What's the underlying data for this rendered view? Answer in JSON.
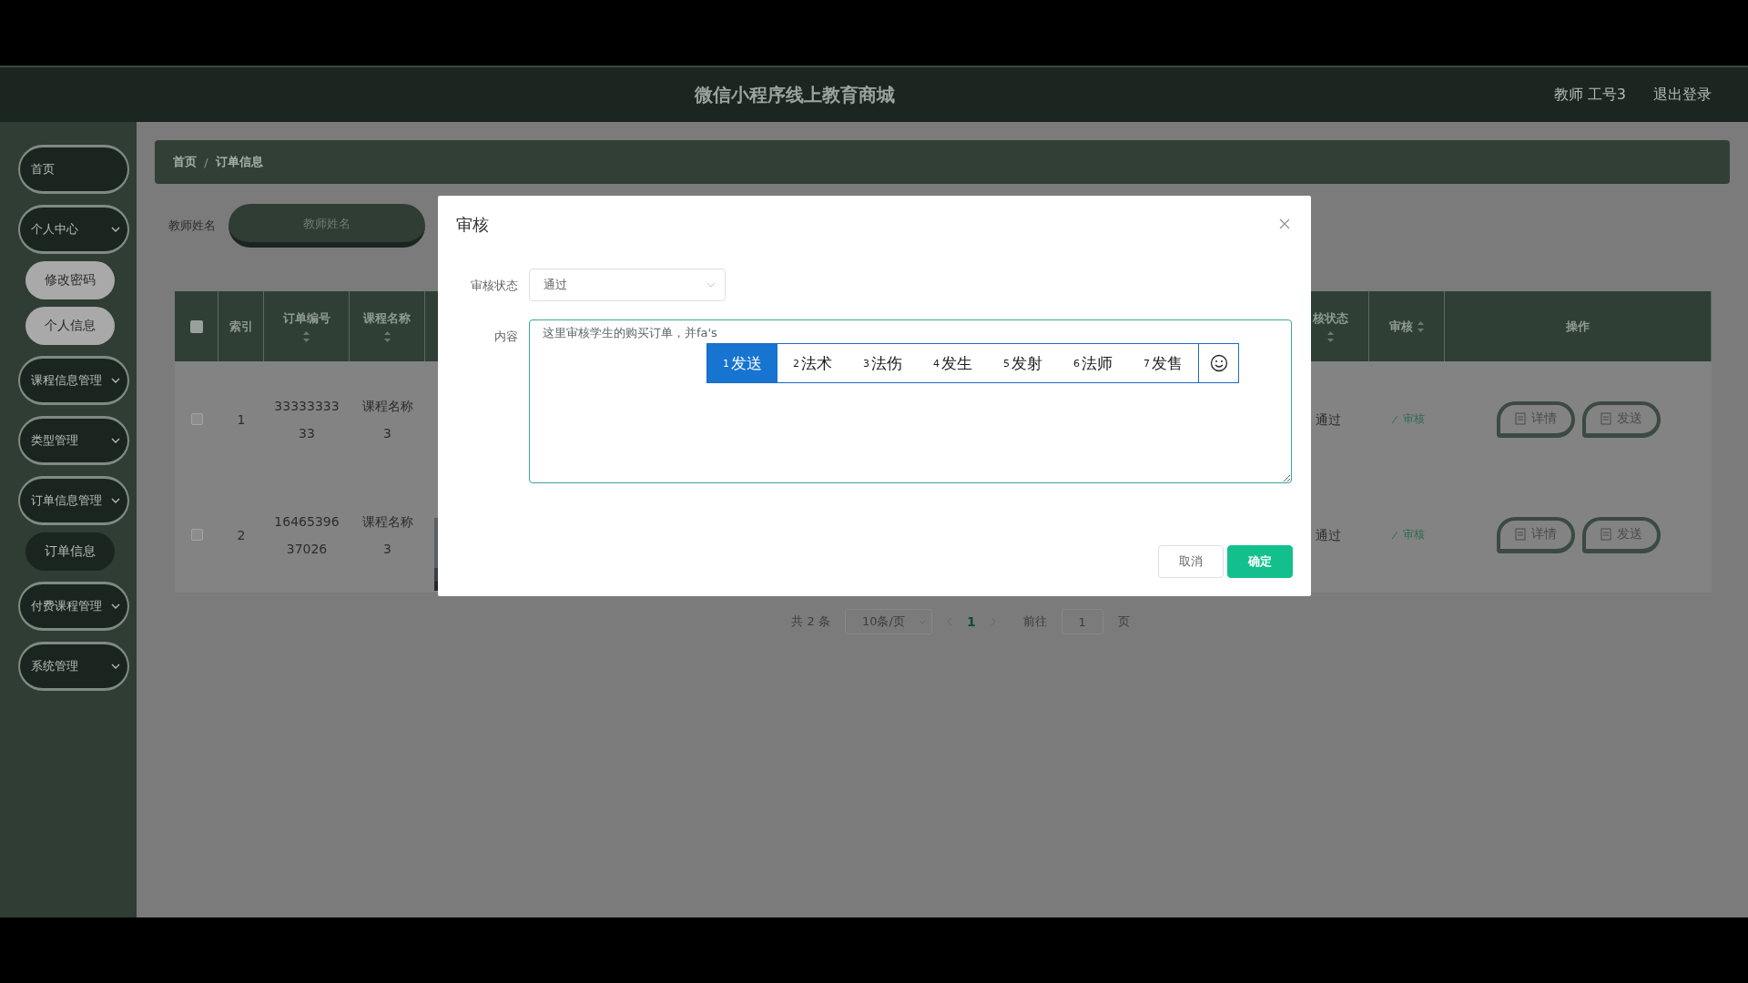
{
  "header": {
    "title": "微信小程序线上教育商城",
    "user": "教师 工号3",
    "logout": "退出登录"
  },
  "sidebar": {
    "items": [
      {
        "label": "首页",
        "has_arrow": false
      },
      {
        "label": "个人中心",
        "has_arrow": true,
        "children": [
          {
            "label": "修改密码",
            "selected": false
          },
          {
            "label": "个人信息",
            "selected": false
          }
        ]
      },
      {
        "label": "课程信息管理",
        "has_arrow": true
      },
      {
        "label": "类型管理",
        "has_arrow": true
      },
      {
        "label": "订单信息管理",
        "has_arrow": true,
        "children": [
          {
            "label": "订单信息",
            "selected": true
          }
        ]
      },
      {
        "label": "付费课程管理",
        "has_arrow": true
      },
      {
        "label": "系统管理",
        "has_arrow": true
      }
    ]
  },
  "breadcrumb": {
    "items": [
      "首页",
      "订单信息"
    ],
    "separator": "/"
  },
  "search": {
    "label": "教师姓名",
    "placeholder": "教师姓名"
  },
  "table": {
    "all_checked": false,
    "columns": [
      {
        "label": "索引",
        "sortable": false
      },
      {
        "label": "订单编号",
        "sortable": true
      },
      {
        "label": "课程名称",
        "sortable": true
      },
      {
        "label": "核状态",
        "sortable": true
      },
      {
        "label": "审核",
        "sortable": true
      },
      {
        "label": "操作",
        "sortable": false
      }
    ],
    "rows": [
      {
        "checked": false,
        "index": "1",
        "order_no": "3333333333",
        "course": "课程名称3",
        "picture": false,
        "status": "通过",
        "review": "审核",
        "actions": [
          "详情",
          "发送"
        ]
      },
      {
        "checked": false,
        "index": "2",
        "order_no": "1646539637026",
        "course": "课程名称3",
        "picture": true,
        "status": "通过",
        "review": "审核",
        "actions": [
          "详情",
          "发送"
        ]
      }
    ]
  },
  "pagination": {
    "total": "共 2 条",
    "page_size": "10条/页",
    "pages": [
      {
        "label": "1",
        "selected": true
      }
    ],
    "goto_label": "前往",
    "goto_value": "1",
    "goto_suffix": "页"
  },
  "dialog": {
    "title": "审核",
    "fields": [
      {
        "kind": "select",
        "label": "审核状态",
        "value": "通过"
      },
      {
        "kind": "textarea",
        "label": "内容",
        "value": "这里审核学生的购买订单，并fa's"
      }
    ],
    "buttons": [
      {
        "label": "取消",
        "primary": false
      },
      {
        "label": "确定",
        "primary": true
      }
    ]
  },
  "ime": {
    "candidates": [
      {
        "number": "1",
        "text": "发送",
        "selected": true
      },
      {
        "number": "2",
        "text": "法术",
        "selected": false
      },
      {
        "number": "3",
        "text": "法伤",
        "selected": false
      },
      {
        "number": "4",
        "text": "发生",
        "selected": false
      },
      {
        "number": "5",
        "text": "发射",
        "selected": false
      },
      {
        "number": "6",
        "text": "法师",
        "selected": false
      },
      {
        "number": "7",
        "text": "发售",
        "selected": false
      }
    ]
  }
}
